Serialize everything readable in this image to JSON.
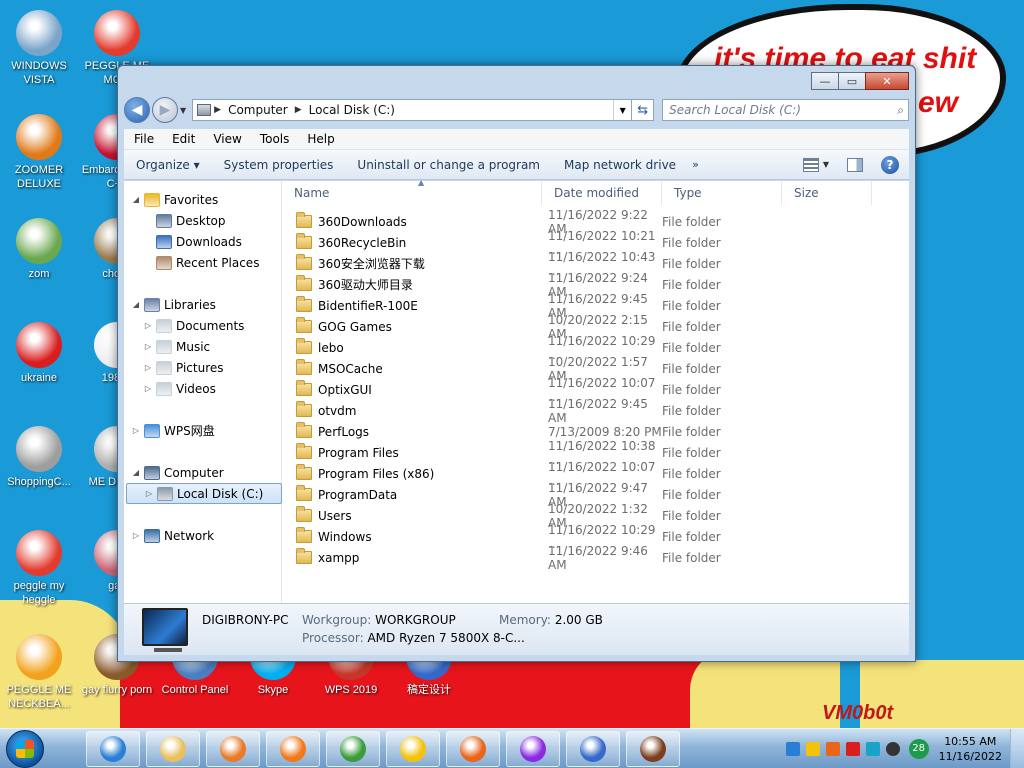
{
  "desktop": {
    "bubble_line1": "it's time to eat shit",
    "bubble_line2": "ew",
    "corner_text": "VM0b0t",
    "icons": [
      {
        "label": "WINDOWS VISTA",
        "color": "#7aa4c8"
      },
      {
        "label": "PEGGLE ME MOM",
        "color": "#e33b2e"
      },
      {
        "label": "ZOOMER DELUXE",
        "color": "#e07a18"
      },
      {
        "label": "Embarca Dev-C++",
        "color": "#c8102e"
      },
      {
        "label": "zom",
        "color": "#6aa84f"
      },
      {
        "label": "chomi",
        "color": "#9a7b4f"
      },
      {
        "label": "ukraine",
        "color": "#d81e1e"
      },
      {
        "label": "1984.t",
        "color": "#eeeeee"
      },
      {
        "label": "ShoppingC...",
        "color": "#9e9e9e"
      },
      {
        "label": "ME DESTR",
        "color": "#b0b0b0"
      },
      {
        "label": "peggle my heggle",
        "color": "#e33b2e"
      },
      {
        "label": "gay",
        "color": "#cc6677"
      },
      {
        "label": "PEGGLE ME NECKBEA...",
        "color": "#f2a21c"
      },
      {
        "label": "gay flurry porn",
        "color": "#8b5a2b"
      },
      {
        "label": "Control Panel",
        "color": "#4a7fc1"
      },
      {
        "label": "Skype",
        "color": "#00aff0"
      },
      {
        "label": "WPS 2019",
        "color": "#c7362b"
      },
      {
        "label": "稿定设计",
        "color": "#3569c9"
      }
    ]
  },
  "window": {
    "caption": {
      "minimize": "—",
      "maximize": "▭",
      "close": "✕"
    },
    "address": {
      "segments": [
        "Computer",
        "Local Disk (C:)"
      ]
    },
    "search": {
      "placeholder": "Search Local Disk (C:)"
    },
    "menu": [
      "File",
      "Edit",
      "View",
      "Tools",
      "Help"
    ],
    "commands": [
      "Organize ▾",
      "System properties",
      "Uninstall or change a program",
      "Map network drive",
      "»"
    ],
    "nav_tree": [
      {
        "label": "Favorites",
        "level": 0,
        "arrow": "◢",
        "icon_color": "#e8b828"
      },
      {
        "label": "Desktop",
        "level": 1,
        "arrow": "",
        "icon_color": "#5f7da0"
      },
      {
        "label": "Downloads",
        "level": 1,
        "arrow": "",
        "icon_color": "#3a6fc0"
      },
      {
        "label": "Recent Places",
        "level": 1,
        "arrow": "",
        "icon_color": "#b08a6a"
      },
      {
        "label": "Libraries",
        "level": 0,
        "arrow": "◢",
        "icon_color": "#6a82a8"
      },
      {
        "label": "Documents",
        "level": 1,
        "arrow": "▷",
        "icon_color": "#c8d0d8"
      },
      {
        "label": "Music",
        "level": 1,
        "arrow": "▷",
        "icon_color": "#c8d0d8"
      },
      {
        "label": "Pictures",
        "level": 1,
        "arrow": "▷",
        "icon_color": "#c8d0d8"
      },
      {
        "label": "Videos",
        "level": 1,
        "arrow": "▷",
        "icon_color": "#c8d0d8"
      },
      {
        "label": "WPS网盘",
        "level": 0,
        "arrow": "▷",
        "icon_color": "#4a90d6"
      },
      {
        "label": "Computer",
        "level": 0,
        "arrow": "◢",
        "icon_color": "#4d6a90"
      },
      {
        "label": "Local Disk (C:)",
        "level": 1,
        "arrow": "▷",
        "icon_color": "#8e99a6",
        "selected": true
      },
      {
        "label": "Network",
        "level": 0,
        "arrow": "▷",
        "icon_color": "#3a6fa8"
      }
    ],
    "columns": [
      "Name",
      "Date modified",
      "Type",
      "Size"
    ],
    "files": [
      {
        "name": "360Downloads",
        "date": "11/16/2022 9:22 AM",
        "type": "File folder"
      },
      {
        "name": "360RecycleBin",
        "date": "11/16/2022 10:21 ...",
        "type": "File folder"
      },
      {
        "name": "360安全浏览器下载",
        "date": "11/16/2022 10:43 ...",
        "type": "File folder"
      },
      {
        "name": "360驱动大师目录",
        "date": "11/16/2022 9:24 AM",
        "type": "File folder"
      },
      {
        "name": "BidentifieR-100E",
        "date": "11/16/2022 9:45 AM",
        "type": "File folder"
      },
      {
        "name": "GOG Games",
        "date": "10/20/2022 2:15 AM",
        "type": "File folder"
      },
      {
        "name": "lebo",
        "date": "11/16/2022 10:29 ...",
        "type": "File folder"
      },
      {
        "name": "MSOCache",
        "date": "10/20/2022 1:57 AM",
        "type": "File folder"
      },
      {
        "name": "OptixGUI",
        "date": "11/16/2022 10:07 ...",
        "type": "File folder"
      },
      {
        "name": "otvdm",
        "date": "11/16/2022 9:45 AM",
        "type": "File folder"
      },
      {
        "name": "PerfLogs",
        "date": "7/13/2009 8:20 PM",
        "type": "File folder"
      },
      {
        "name": "Program Files",
        "date": "11/16/2022 10:38 ...",
        "type": "File folder"
      },
      {
        "name": "Program Files (x86)",
        "date": "11/16/2022 10:07 ...",
        "type": "File folder"
      },
      {
        "name": "ProgramData",
        "date": "11/16/2022 9:47 AM",
        "type": "File folder"
      },
      {
        "name": "Users",
        "date": "10/20/2022 1:32 AM",
        "type": "File folder"
      },
      {
        "name": "Windows",
        "date": "11/16/2022 10:29 ...",
        "type": "File folder"
      },
      {
        "name": "xampp",
        "date": "11/16/2022 9:46 AM",
        "type": "File folder"
      }
    ],
    "details": {
      "pc_name": "DIGIBRONY-PC",
      "workgroup_label": "Workgroup:",
      "workgroup_value": "WORKGROUP",
      "memory_label": "Memory:",
      "memory_value": "2.00 GB",
      "processor_label": "Processor:",
      "processor_value": "AMD Ryzen 7 5800X 8-C..."
    }
  },
  "taskbar": {
    "buttons": [
      {
        "name": "internet-explorer",
        "color": "#2a7fd4"
      },
      {
        "name": "file-explorer",
        "color": "#e8c060"
      },
      {
        "name": "media-player",
        "color": "#e87a2a"
      },
      {
        "name": "uc-browser",
        "color": "#f07a1a"
      },
      {
        "name": "chrome",
        "color": "#3a9c3a"
      },
      {
        "name": "plus-app",
        "color": "#f2c20c"
      },
      {
        "name": "firefox",
        "color": "#e8651a"
      },
      {
        "name": "mask-app",
        "color": "#8a2be2"
      },
      {
        "name": "gaoding",
        "color": "#3569c9"
      },
      {
        "name": "sword-app",
        "color": "#7b3f1f"
      }
    ],
    "tray_badge": "28",
    "time": "10:55 AM",
    "date": "11/16/2022"
  }
}
